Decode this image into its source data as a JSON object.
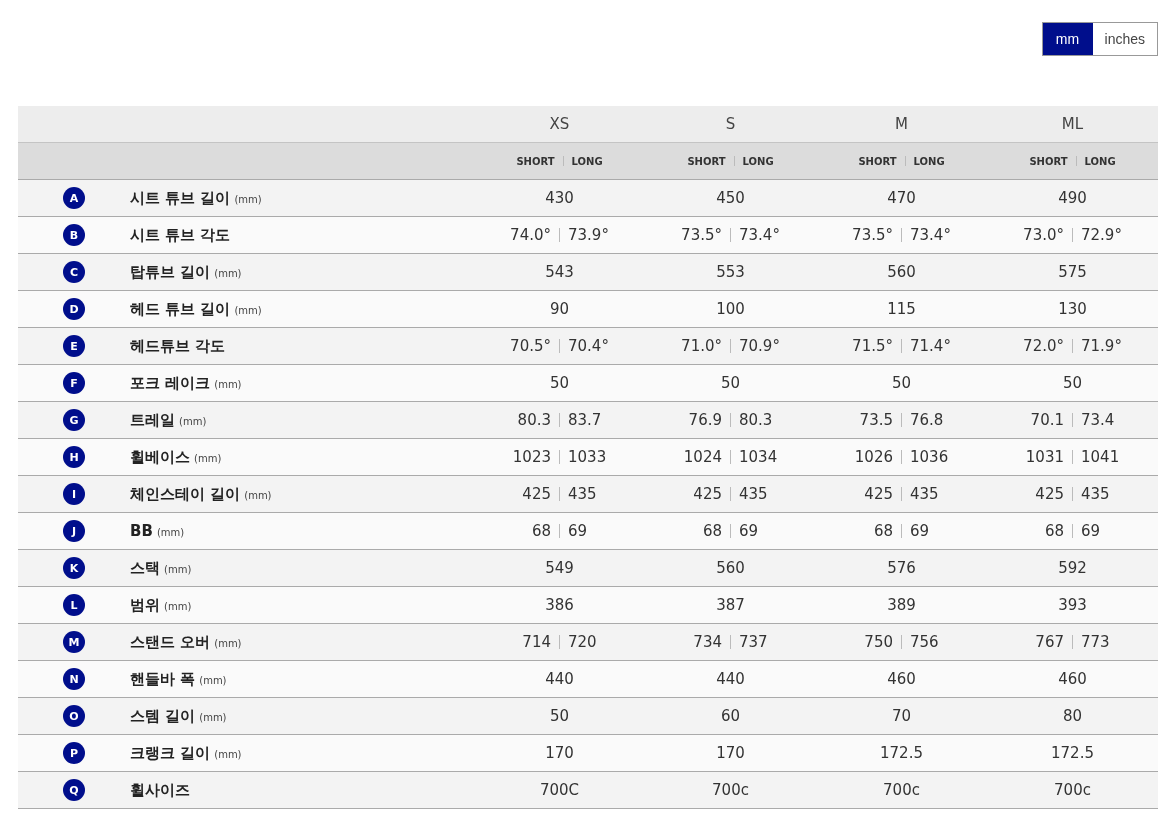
{
  "unit_toggle": [
    {
      "label": "mm",
      "selected": true
    },
    {
      "label": "inches",
      "selected": false
    }
  ],
  "table": {
    "sizes": [
      "XS",
      "S",
      "M",
      "ML"
    ],
    "subheader": [
      [
        "SHORT",
        "LONG"
      ],
      [
        "SHORT",
        "LONG"
      ],
      [
        "SHORT",
        "LONG"
      ],
      [
        "SHORT",
        "LONG"
      ]
    ],
    "rows": [
      {
        "letter": "A",
        "name": "시트 튜브 길이",
        "unit": "(mm)",
        "cells": [
          [
            "430"
          ],
          [
            "450"
          ],
          [
            "470"
          ],
          [
            "490"
          ]
        ]
      },
      {
        "letter": "B",
        "name": "시트 튜브 각도",
        "cells": [
          [
            "74.0°",
            "73.9°"
          ],
          [
            "73.5°",
            "73.4°"
          ],
          [
            "73.5°",
            "73.4°"
          ],
          [
            "73.0°",
            "72.9°"
          ]
        ]
      },
      {
        "letter": "C",
        "name": "탑튜브 길이",
        "unit": "(mm)",
        "cells": [
          [
            "543"
          ],
          [
            "553"
          ],
          [
            "560"
          ],
          [
            "575"
          ]
        ]
      },
      {
        "letter": "D",
        "name": "헤드 튜브 길이",
        "unit": "(mm)",
        "cells": [
          [
            "90"
          ],
          [
            "100"
          ],
          [
            "115"
          ],
          [
            "130"
          ]
        ]
      },
      {
        "letter": "E",
        "name": "헤드튜브 각도",
        "cells": [
          [
            "70.5°",
            "70.4°"
          ],
          [
            "71.0°",
            "70.9°"
          ],
          [
            "71.5°",
            "71.4°"
          ],
          [
            "72.0°",
            "71.9°"
          ]
        ]
      },
      {
        "letter": "F",
        "name": "포크 레이크",
        "unit": "(mm)",
        "cells": [
          [
            "50"
          ],
          [
            "50"
          ],
          [
            "50"
          ],
          [
            "50"
          ]
        ]
      },
      {
        "letter": "G",
        "name": "트레일",
        "unit": "(mm)",
        "cells": [
          [
            "80.3",
            "83.7"
          ],
          [
            "76.9",
            "80.3"
          ],
          [
            "73.5",
            "76.8"
          ],
          [
            "70.1",
            "73.4"
          ]
        ]
      },
      {
        "letter": "H",
        "name": "휠베이스",
        "unit": "(mm)",
        "cells": [
          [
            "1023",
            "1033"
          ],
          [
            "1024",
            "1034"
          ],
          [
            "1026",
            "1036"
          ],
          [
            "1031",
            "1041"
          ]
        ]
      },
      {
        "letter": "I",
        "name": "체인스테이 길이",
        "unit": "(mm)",
        "cells": [
          [
            "425",
            "435"
          ],
          [
            "425",
            "435"
          ],
          [
            "425",
            "435"
          ],
          [
            "425",
            "435"
          ]
        ]
      },
      {
        "letter": "J",
        "name": "BB",
        "unit": "(mm)",
        "cells": [
          [
            "68",
            "69"
          ],
          [
            "68",
            "69"
          ],
          [
            "68",
            "69"
          ],
          [
            "68",
            "69"
          ]
        ]
      },
      {
        "letter": "K",
        "name": "스택",
        "unit": "(mm)",
        "cells": [
          [
            "549"
          ],
          [
            "560"
          ],
          [
            "576"
          ],
          [
            "592"
          ]
        ]
      },
      {
        "letter": "L",
        "name": "범위",
        "unit": "(mm)",
        "cells": [
          [
            "386"
          ],
          [
            "387"
          ],
          [
            "389"
          ],
          [
            "393"
          ]
        ]
      },
      {
        "letter": "M",
        "name": "스탠드 오버",
        "unit": "(mm)",
        "cells": [
          [
            "714",
            "720"
          ],
          [
            "734",
            "737"
          ],
          [
            "750",
            "756"
          ],
          [
            "767",
            "773"
          ]
        ]
      },
      {
        "letter": "N",
        "name": "핸들바 폭",
        "unit": "(mm)",
        "cells": [
          [
            "440"
          ],
          [
            "440"
          ],
          [
            "460"
          ],
          [
            "460"
          ]
        ]
      },
      {
        "letter": "O",
        "name": "스템 길이",
        "unit": "(mm)",
        "cells": [
          [
            "50"
          ],
          [
            "60"
          ],
          [
            "70"
          ],
          [
            "80"
          ]
        ]
      },
      {
        "letter": "P",
        "name": "크랭크 길이",
        "unit": "(mm)",
        "cells": [
          [
            "170"
          ],
          [
            "170"
          ],
          [
            "172.5"
          ],
          [
            "172.5"
          ]
        ]
      },
      {
        "letter": "Q",
        "name": "휠사이즈",
        "cells": [
          [
            "700C"
          ],
          [
            "700c"
          ],
          [
            "700c"
          ],
          [
            "700c"
          ]
        ]
      }
    ]
  }
}
